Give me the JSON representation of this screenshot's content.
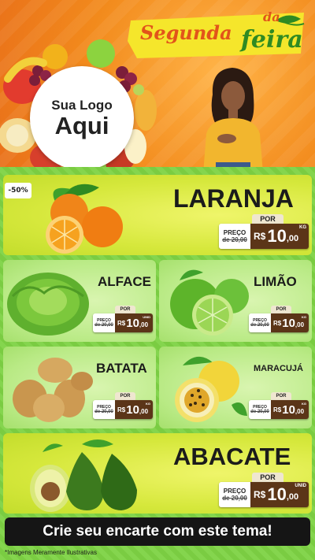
{
  "header": {
    "logo_line1": "Sua Logo",
    "logo_line2": "Aqui",
    "title_segunda": "Segunda",
    "title_da": "da",
    "title_feira": "feira"
  },
  "discount_badge": "-50%",
  "products": [
    {
      "name": "LARANJA",
      "por": "POR",
      "preco_label": "PREÇO",
      "de_price": "de 20,00",
      "currency": "R$",
      "price": "10",
      "cents": ",00",
      "unit": "KG"
    },
    {
      "name": "ALFACE",
      "por": "POR",
      "preco_label": "PREÇO",
      "de_price": "de 20,00",
      "currency": "R$",
      "price": "10",
      "cents": ",00",
      "unit": "UNID"
    },
    {
      "name": "LIMÃO",
      "por": "POR",
      "preco_label": "PREÇO",
      "de_price": "de 20,00",
      "currency": "R$",
      "price": "10",
      "cents": ",00",
      "unit": "KG"
    },
    {
      "name": "BATATA",
      "por": "POR",
      "preco_label": "PREÇO",
      "de_price": "de 20,00",
      "currency": "R$",
      "price": "10",
      "cents": ",00",
      "unit": "KG"
    },
    {
      "name": "MARACUJÁ",
      "por": "POR",
      "preco_label": "PREÇO",
      "de_price": "de 20,00",
      "currency": "R$",
      "price": "10",
      "cents": ",00",
      "unit": "KG"
    },
    {
      "name": "ABACATE",
      "por": "POR",
      "preco_label": "PREÇO",
      "de_price": "de 20,00",
      "currency": "R$",
      "price": "10",
      "cents": ",00",
      "unit": "UNID"
    }
  ],
  "cta": "Crie seu encarte com este tema!",
  "disclaimer": "*Imagens Meramente Ilustrativas",
  "colors": {
    "orange": "#f28a1c",
    "green_bg": "#7ed344",
    "price_brown": "#5b3518",
    "feira_green": "#2f8a22"
  }
}
